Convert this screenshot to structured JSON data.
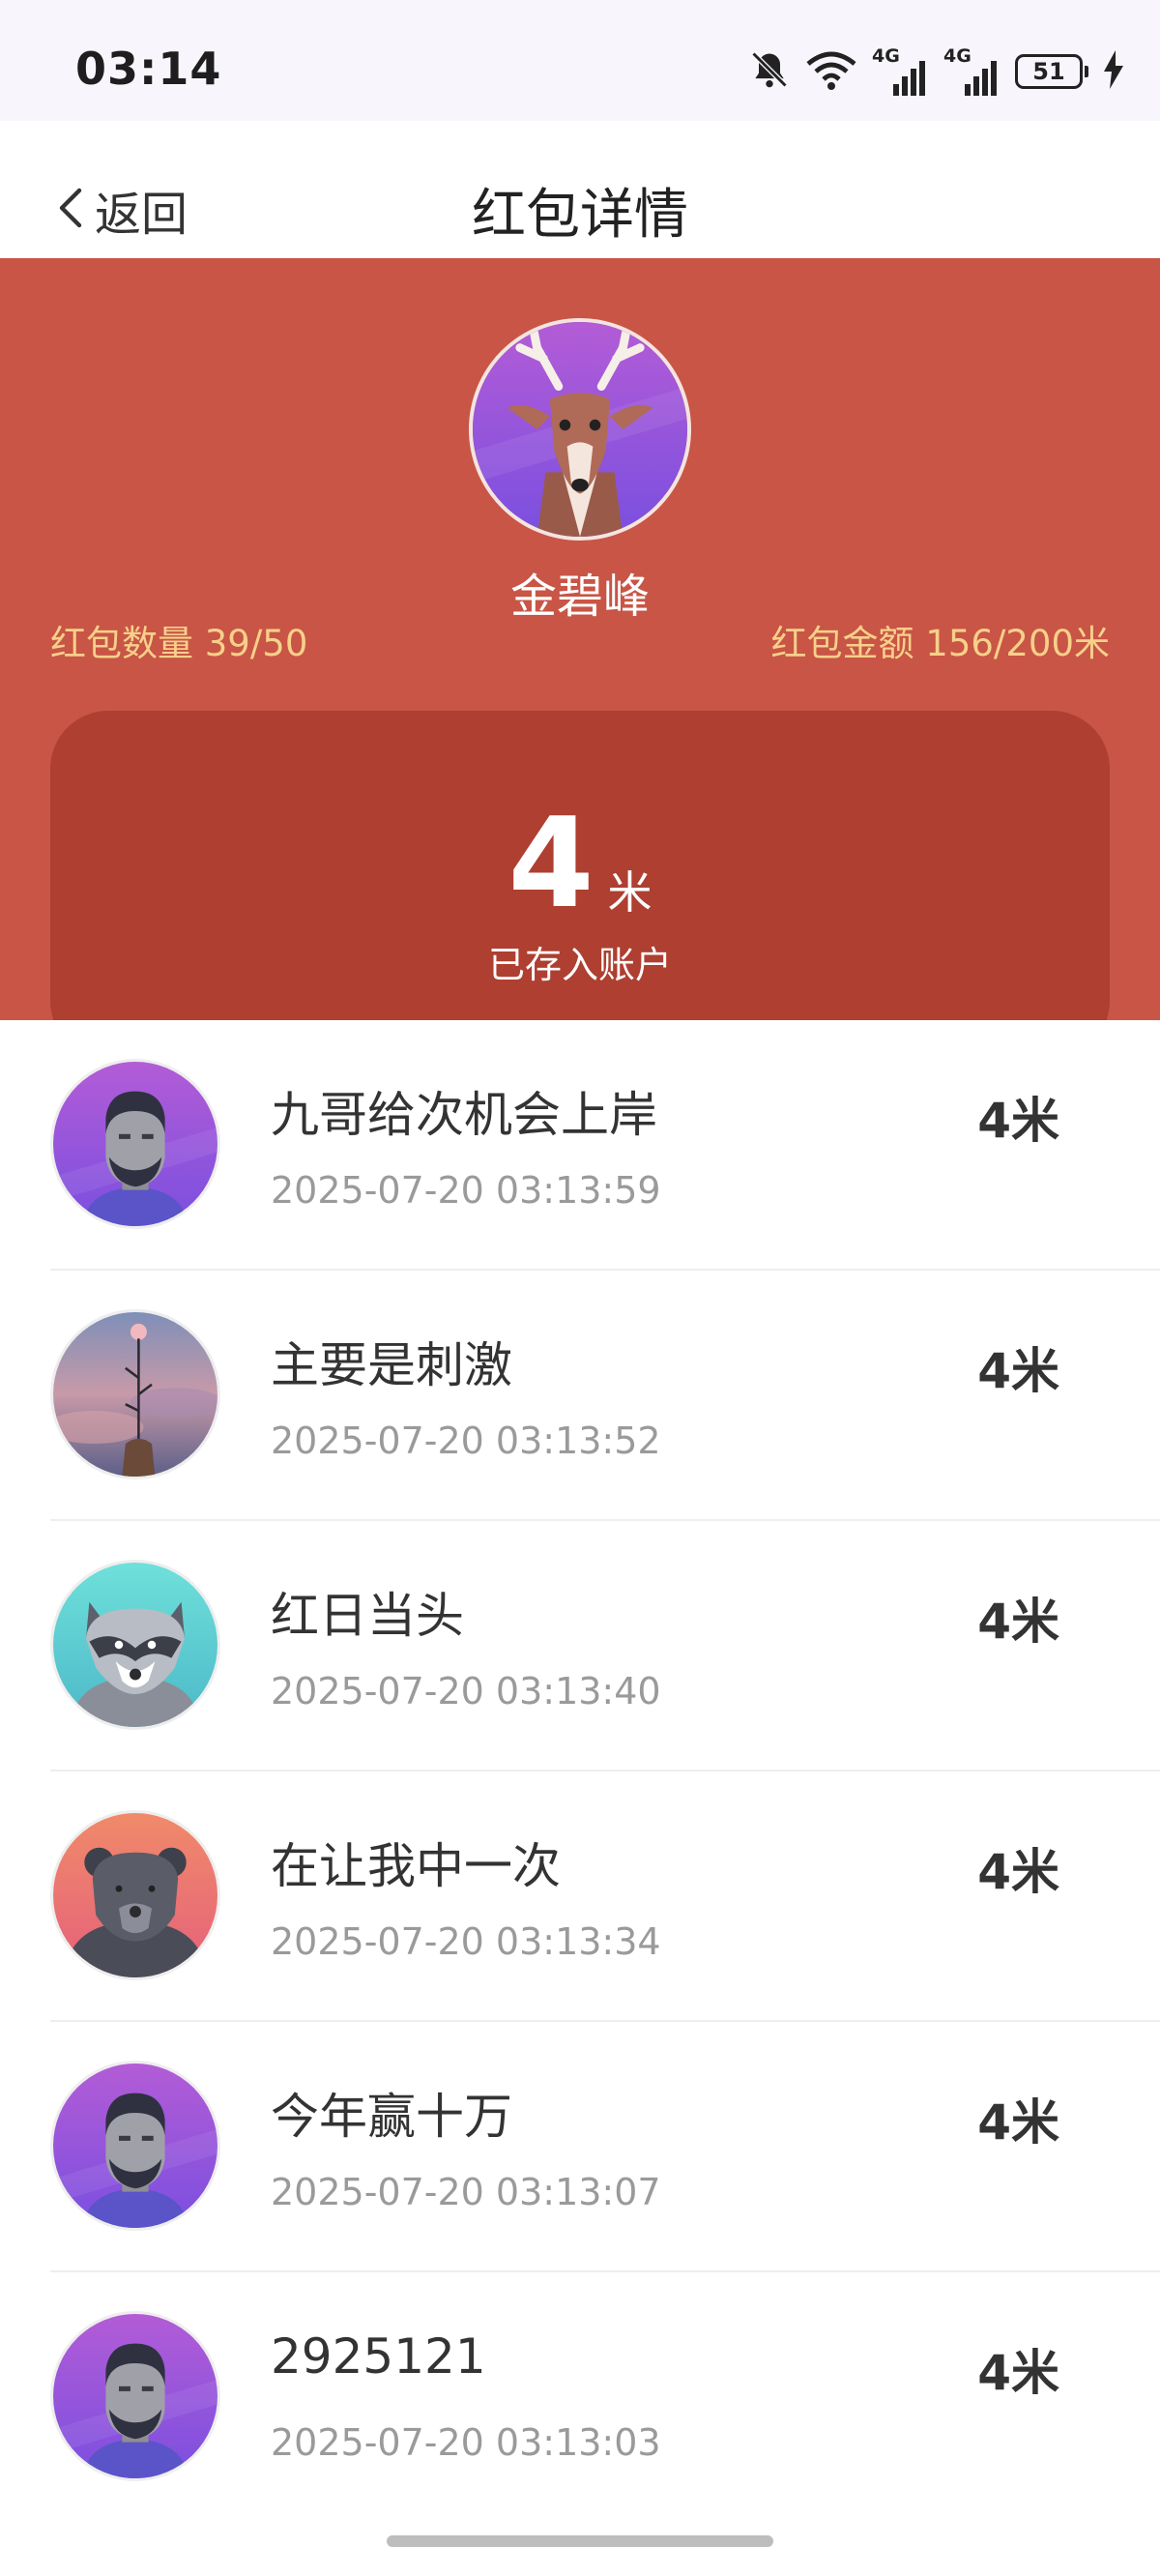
{
  "status_bar": {
    "time": "03:14",
    "network1": "4G",
    "network2": "4G",
    "battery": "51",
    "icons": [
      "bell-muted-icon",
      "wifi-icon",
      "signal-icon",
      "signal-icon",
      "battery-icon",
      "charging-icon"
    ]
  },
  "nav": {
    "back_label": "返回",
    "title": "红包详情"
  },
  "header": {
    "sender_name": "金碧峰",
    "count_label": "红包数量 39/50",
    "total_label": "红包金额 156/200米",
    "received_amount": "4",
    "received_unit": "米",
    "received_note": "已存入账户"
  },
  "claims": [
    {
      "nickname": "九哥给次机会上岸",
      "time": "2025-07-20 03:13:59",
      "amount": "4米",
      "avatar": "man-avatar-icon"
    },
    {
      "nickname": "主要是刺激",
      "time": "2025-07-20 03:13:52",
      "amount": "4米",
      "avatar": "photo-avatar-icon"
    },
    {
      "nickname": "红日当头",
      "time": "2025-07-20 03:13:40",
      "amount": "4米",
      "avatar": "raccoon-avatar-icon"
    },
    {
      "nickname": "在让我中一次",
      "time": "2025-07-20 03:13:34",
      "amount": "4米",
      "avatar": "bear-avatar-icon"
    },
    {
      "nickname": "今年赢十万",
      "time": "2025-07-20 03:13:07",
      "amount": "4米",
      "avatar": "man-avatar-icon"
    },
    {
      "nickname": "2925121",
      "time": "2025-07-20 03:13:03",
      "amount": "4米",
      "avatar": "man-avatar-icon"
    }
  ],
  "colors": {
    "header_red": "#c85546",
    "card_red": "#ae3f31",
    "stat_gold": "#f7d08a"
  }
}
